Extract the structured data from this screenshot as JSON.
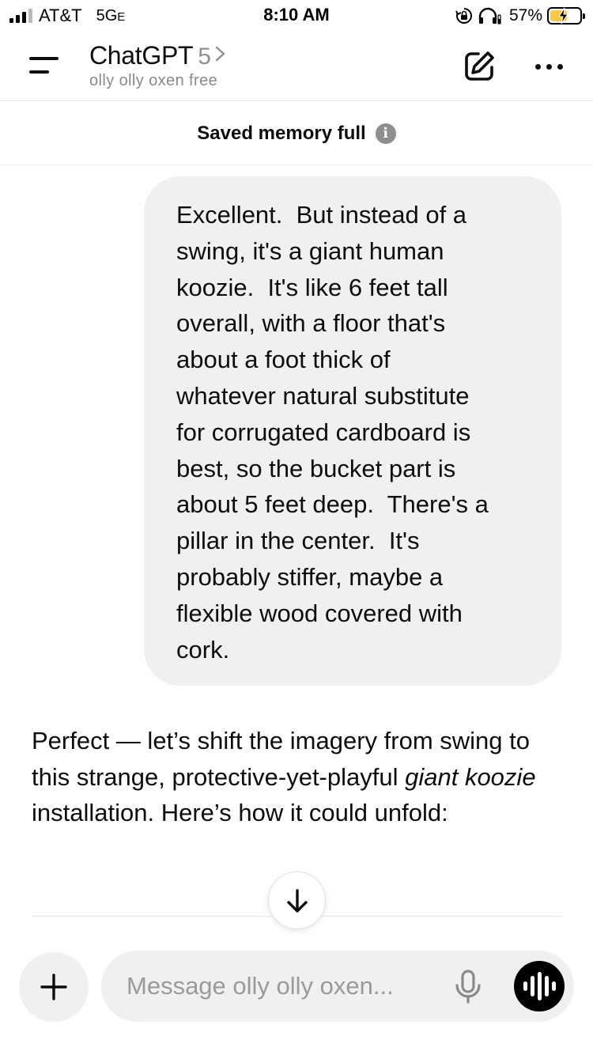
{
  "status_bar": {
    "carrier": "AT&T",
    "network_main": "5G",
    "network_sub": "E",
    "time": "8:10 AM",
    "battery_percent": "57%",
    "battery_level": 0.57,
    "icons": [
      "signal-icon",
      "rotation-lock-icon",
      "headphones-icon",
      "battery-charging-icon"
    ]
  },
  "header": {
    "app_title": "ChatGPT",
    "model_version": "5",
    "project_name": "olly olly oxen free",
    "icons": [
      "menu-icon",
      "chevron-right-icon",
      "new-chat-icon",
      "more-icon"
    ]
  },
  "banner": {
    "text": "Saved memory full",
    "icon": "info-icon"
  },
  "messages": [
    {
      "role": "user",
      "text": "Excellent.  But instead of a\nswing, it's a giant human\nkoozie.  It's like 6 feet tall\noverall, with a floor that's\nabout a foot thick of\nwhatever natural substitute\nfor corrugated cardboard is\nbest, so the bucket part is\nabout 5 feet deep.  There's a\npillar in the center.  It's\nprobably stiffer, maybe a\nflexible wood covered with\ncork."
    },
    {
      "role": "assistant",
      "text_part1": "Perfect — let’s shift the imagery from swing to this strange, protective-yet-playful ",
      "text_italic1": "giant koozie",
      "text_part2": " installation. Here’s how it could unfold:"
    }
  ],
  "composer": {
    "placeholder": "Message olly olly oxen...",
    "icons": [
      "plus-icon",
      "microphone-icon",
      "voice-mode-icon",
      "arrow-down-icon"
    ]
  },
  "colors": {
    "bubble_background": "#f0f0f0",
    "battery_fill": "#f7c948",
    "text": "#0d0d0d",
    "muted": "#8a8a8a"
  }
}
